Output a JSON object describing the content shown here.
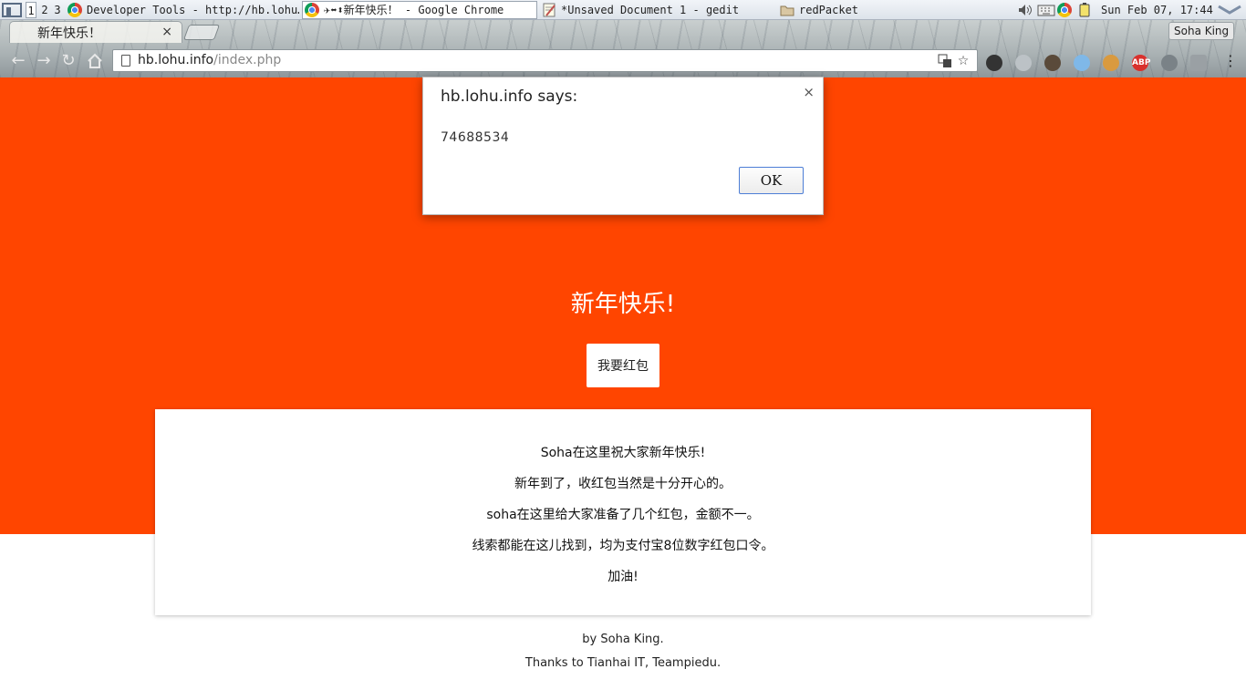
{
  "taskbar": {
    "workspaces": [
      "1",
      "2",
      "3"
    ],
    "tasks": [
      {
        "label": "Developer Tools - http://hb.lohu…",
        "icon": "chrome-icon"
      },
      {
        "label": "✈⬌⬍新年快乐！ - Google Chrome",
        "icon": "chrome-icon"
      },
      {
        "label": "*Unsaved Document 1 - gedit",
        "icon": "gedit-icon"
      },
      {
        "label": "redPacket",
        "icon": "folder-icon"
      }
    ],
    "clock": "Sun Feb 07, 17:44"
  },
  "browser": {
    "tab_title": "新年快乐！",
    "tab_close": "×",
    "profile_name": "Soha King",
    "url_host": "hb.lohu.info",
    "url_path": "/index.php",
    "extensions": [
      "ABP"
    ]
  },
  "page": {
    "hero_title": "新年快乐!",
    "button_label": "我要红包",
    "card_lines": [
      "Soha在这里祝大家新年快乐!",
      "新年到了，收红包当然是十分开心的。",
      "soha在这里给大家准备了几个红包，金额不一。",
      "线索都能在这儿找到，均为支付宝8位数字红包口令。",
      "加油!"
    ],
    "footer_lines": [
      "by Soha King.",
      "Thanks to Tianhai IT, Teampiedu."
    ],
    "colors": {
      "hero_bg": "#ff4500",
      "card_bg": "#ffffff"
    }
  },
  "alert": {
    "title": "hb.lohu.info says:",
    "message": "74688534",
    "ok_label": "OK",
    "close": "×"
  }
}
